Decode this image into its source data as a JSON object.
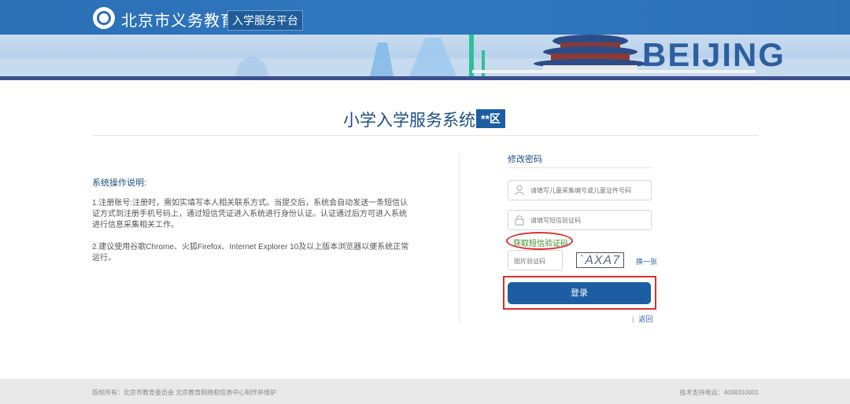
{
  "header": {
    "site_title": "北京市义务教育",
    "platform_tag": "入学服务平台",
    "banner_word": "BEIJING"
  },
  "main": {
    "system_title": "小学入学服务系统",
    "district_badge": "**区"
  },
  "instructions": {
    "heading": "系统操作说明:",
    "item1": "1.注册账号:注册时，需如实填写本人相关联系方式。当提交后，系统会自动发送一条短信认证方式到注册手机号码上，通过短信凭证进入系统进行身份认证。认证通过后方可进入系统进行信息采集相关工作。",
    "item2": "2.建议使用谷歌Chrome、火狐Firefox、Internet Explorer 10及以上版本浏览器以便系统正常运行。"
  },
  "form": {
    "heading": "修改密码",
    "id_placeholder": "请填写儿童采集编号或儿童证件号码",
    "sms_placeholder": "请填写短信验证码",
    "get_sms_link": "获取短信验证码",
    "captcha_placeholder": "图片验证码",
    "captcha_text": "`AXA7",
    "refresh_link": "换一张",
    "login_button": "登录",
    "back_link": "返回"
  },
  "footer": {
    "copyright": "版权所有：北京市教育委员会 北京教育网络和信息中心制作并维护",
    "support": "技术支持电话：4008310001"
  },
  "colors": {
    "primary": "#1d5ea3",
    "header_blue": "#2b6fb4",
    "highlight_red": "#d9302f",
    "link_green": "#3d8a2a"
  }
}
